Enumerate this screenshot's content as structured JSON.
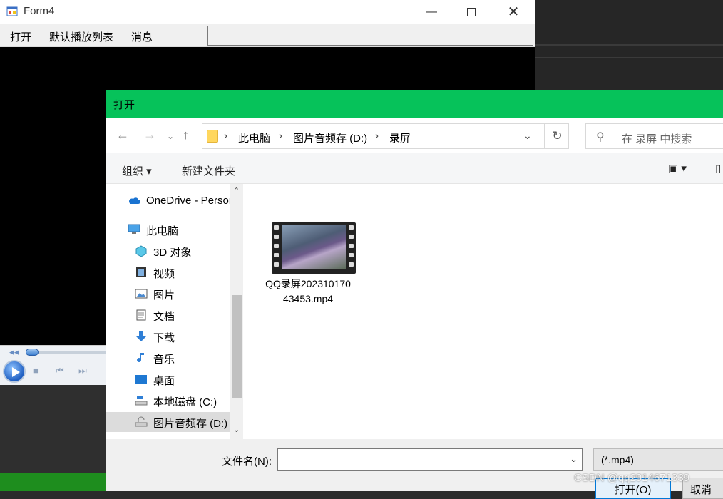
{
  "form4": {
    "title": "Form4",
    "menu": [
      "打开",
      "默认播放列表",
      "消息"
    ],
    "textbox_value": ""
  },
  "dialog": {
    "title": "打开",
    "breadcrumb": [
      "此电脑",
      "图片音频存 (D:)",
      "录屏"
    ],
    "search_placeholder": "在 录屏 中搜索",
    "toolbar": {
      "organize": "组织 ▾",
      "new_folder": "新建文件夹"
    },
    "nav_items": [
      {
        "label": "OneDrive - Personal",
        "icon": "onedrive-icon"
      },
      {
        "label": "此电脑",
        "icon": "computer-icon"
      },
      {
        "label": "3D 对象",
        "icon": "3d-objects-icon"
      },
      {
        "label": "视频",
        "icon": "video-folder-icon"
      },
      {
        "label": "图片",
        "icon": "pictures-icon"
      },
      {
        "label": "文档",
        "icon": "documents-icon"
      },
      {
        "label": "下载",
        "icon": "downloads-icon"
      },
      {
        "label": "音乐",
        "icon": "music-icon"
      },
      {
        "label": "桌面",
        "icon": "desktop-icon"
      },
      {
        "label": "本地磁盘 (C:)",
        "icon": "drive-c-icon"
      },
      {
        "label": "图片音频存 (D:)",
        "icon": "drive-d-icon"
      }
    ],
    "files": [
      {
        "name": "QQ录屏20231017043453.mp4",
        "icon": "video-file-icon"
      }
    ],
    "filename_label": "文件名(N):",
    "filename_value": "",
    "filetype": "(*.mp4)",
    "open_label": "打开(O)",
    "cancel_label": "取消"
  },
  "watermark": "CSDN @qq2914671339",
  "colors": {
    "dialog_titlebar": "#06c25a",
    "selected_bg": "#dcdcdc",
    "accent": "#0078d7"
  }
}
